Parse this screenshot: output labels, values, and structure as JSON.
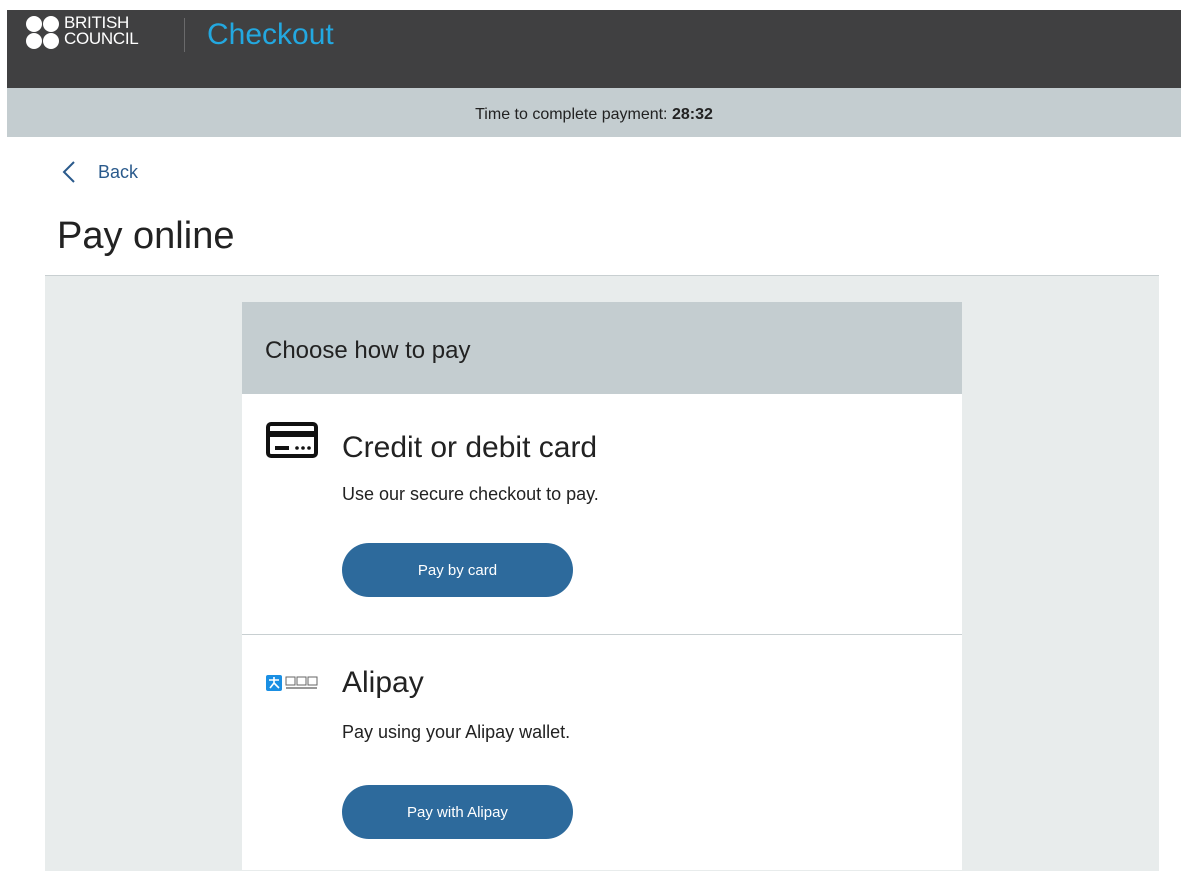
{
  "header": {
    "logo_line1": "BRITISH",
    "logo_line2": "COUNCIL",
    "title": "Checkout",
    "title_color": "#23a8e0",
    "bar_color": "#404041"
  },
  "timer": {
    "label": "Time to complete payment:",
    "value": "28:32"
  },
  "nav": {
    "back_label": "Back",
    "back_icon": "chevron-left-icon"
  },
  "page": {
    "title": "Pay online"
  },
  "payment": {
    "header": "Choose how to pay",
    "options": [
      {
        "icon": "credit-card-icon",
        "title": "Credit or debit card",
        "description": "Use our secure checkout to pay.",
        "button_label": "Pay by card"
      },
      {
        "icon": "alipay-logo-icon",
        "title": "Alipay",
        "description": "Pay using your Alipay wallet.",
        "button_label": "Pay with Alipay"
      }
    ],
    "button_color": "#2d6a9c"
  }
}
